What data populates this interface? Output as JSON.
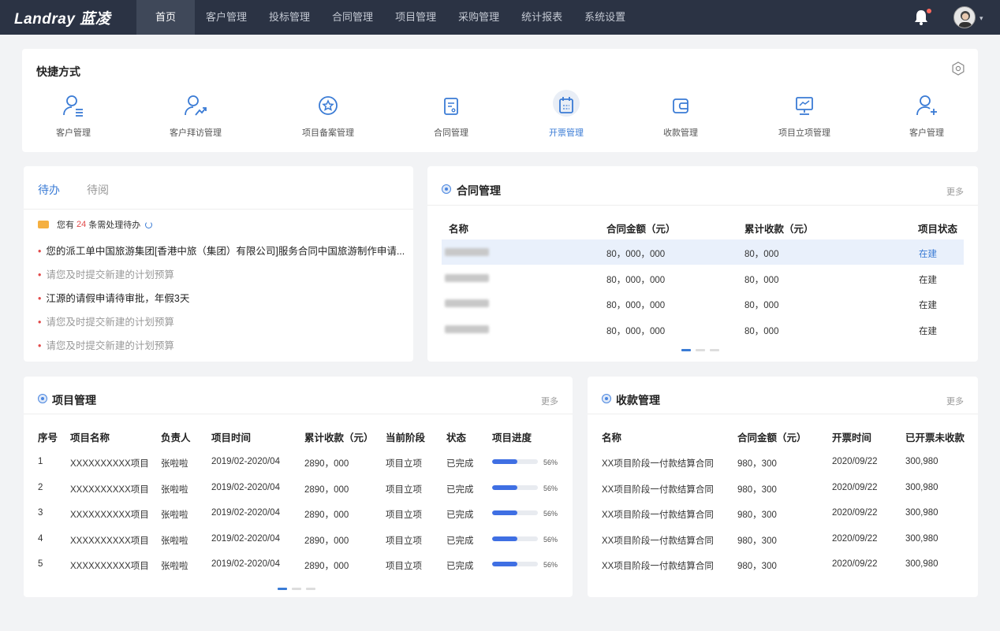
{
  "app": {
    "logo": "Landray 蓝凌"
  },
  "nav": {
    "items": [
      "首页",
      "客户管理",
      "投标管理",
      "合同管理",
      "项目管理",
      "采购管理",
      "统计报表",
      "系统设置"
    ],
    "active_index": 0
  },
  "quick": {
    "title": "快捷方式",
    "items": [
      {
        "label": "客户管理",
        "icon": "customer-list-icon"
      },
      {
        "label": "客户拜访管理",
        "icon": "customer-visit-icon"
      },
      {
        "label": "项目备案管理",
        "icon": "star-circle-icon"
      },
      {
        "label": "合同管理",
        "icon": "contract-doc-icon"
      },
      {
        "label": "开票管理",
        "icon": "calendar-invoice-icon"
      },
      {
        "label": "收款管理",
        "icon": "wallet-icon"
      },
      {
        "label": "项目立项管理",
        "icon": "presentation-icon"
      },
      {
        "label": "客户管理",
        "icon": "add-user-icon"
      }
    ],
    "active_index": 4
  },
  "todo": {
    "tabs": [
      "待办",
      "待阅"
    ],
    "notice_prefix": "您有",
    "notice_count": "24",
    "notice_suffix": "条需处理待办",
    "items": [
      {
        "text": "您的派工单中国旅游集团[香港中旅（集团）有限公司]服务合同中国旅游制作申请...",
        "dim": false
      },
      {
        "text": "请您及时提交新建的计划预算",
        "dim": true
      },
      {
        "text": "江源的请假申请待审批，年假3天",
        "dim": false
      },
      {
        "text": "请您及时提交新建的计划预算",
        "dim": true
      },
      {
        "text": "请您及时提交新建的计划预算",
        "dim": true
      }
    ]
  },
  "contract": {
    "title": "合同管理",
    "more": "更多",
    "headers": [
      "名称",
      "合同金额（元）",
      "累计收款（元）",
      "项目状态"
    ],
    "rows": [
      {
        "amount": "80，000，000",
        "received": "80，000",
        "status": "在建"
      },
      {
        "amount": "80，000，000",
        "received": "80，000",
        "status": "在建"
      },
      {
        "amount": "80，000，000",
        "received": "80，000",
        "status": "在建"
      },
      {
        "amount": "80，000，000",
        "received": "80，000",
        "status": "在建"
      }
    ]
  },
  "project": {
    "title": "项目管理",
    "more": "更多",
    "headers": [
      "序号",
      "项目名称",
      "负责人",
      "项目时间",
      "累计收款（元）",
      "当前阶段",
      "状态",
      "项目进度"
    ],
    "rows": [
      {
        "no": "1",
        "name": "XXXXXXXXXX项目",
        "owner": "张啦啦",
        "time": "2019/02-2020/04",
        "received": "2890，000",
        "stage": "项目立项",
        "state": "已完成",
        "progress": 56,
        "progress_label": "56%"
      },
      {
        "no": "2",
        "name": "XXXXXXXXXX项目",
        "owner": "张啦啦",
        "time": "2019/02-2020/04",
        "received": "2890，000",
        "stage": "项目立项",
        "state": "已完成",
        "progress": 56,
        "progress_label": "56%"
      },
      {
        "no": "3",
        "name": "XXXXXXXXXX项目",
        "owner": "张啦啦",
        "time": "2019/02-2020/04",
        "received": "2890，000",
        "stage": "项目立项",
        "state": "已完成",
        "progress": 56,
        "progress_label": "56%"
      },
      {
        "no": "4",
        "name": "XXXXXXXXXX项目",
        "owner": "张啦啦",
        "time": "2019/02-2020/04",
        "received": "2890，000",
        "stage": "项目立项",
        "state": "已完成",
        "progress": 56,
        "progress_label": "56%"
      },
      {
        "no": "5",
        "name": "XXXXXXXXXX项目",
        "owner": "张啦啦",
        "time": "2019/02-2020/04",
        "received": "2890，000",
        "stage": "项目立项",
        "state": "已完成",
        "progress": 56,
        "progress_label": "56%"
      }
    ]
  },
  "payment": {
    "title": "收款管理",
    "more": "更多",
    "headers": [
      "名称",
      "合同金额（元）",
      "开票时间",
      "已开票未收款"
    ],
    "rows": [
      {
        "name": "XX项目阶段一付款结算合同",
        "amount": "980，300",
        "date": "2020/09/22",
        "unpaid": "300,980"
      },
      {
        "name": "XX项目阶段一付款结算合同",
        "amount": "980，300",
        "date": "2020/09/22",
        "unpaid": "300,980"
      },
      {
        "name": "XX项目阶段一付款结算合同",
        "amount": "980，300",
        "date": "2020/09/22",
        "unpaid": "300,980"
      },
      {
        "name": "XX项目阶段一付款结算合同",
        "amount": "980，300",
        "date": "2020/09/22",
        "unpaid": "300,980"
      },
      {
        "name": "XX项目阶段一付款结算合同",
        "amount": "980，300",
        "date": "2020/09/22",
        "unpaid": "300,980"
      }
    ]
  },
  "colors": {
    "primary": "#3a7bd5",
    "nav_bg": "#2b3344",
    "alert": "#e24a4a",
    "progress": "#3f6fe3"
  }
}
